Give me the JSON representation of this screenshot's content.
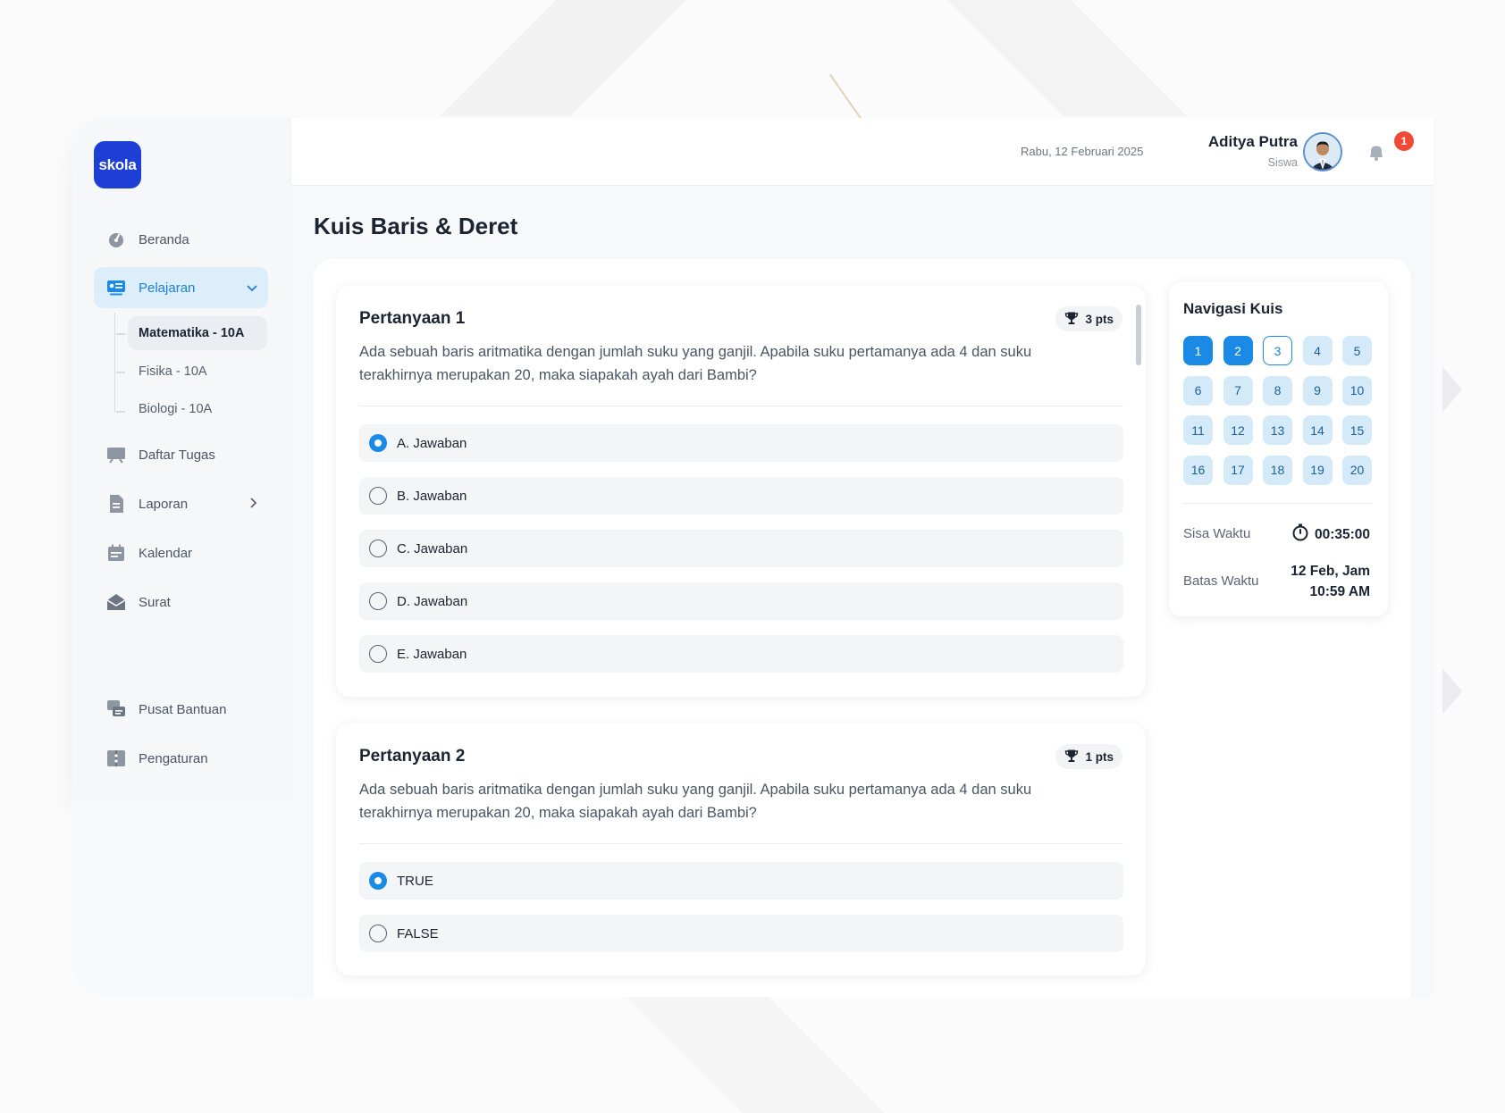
{
  "app": {
    "logo_text": "skola"
  },
  "sidebar": {
    "items": [
      {
        "label": "Beranda",
        "icon": "dashboard-icon"
      },
      {
        "label": "Pelajaran",
        "icon": "lesson-icon"
      },
      {
        "label": "Daftar Tugas",
        "icon": "task-icon"
      },
      {
        "label": "Laporan",
        "icon": "report-icon"
      },
      {
        "label": "Kalendar",
        "icon": "calendar-icon"
      },
      {
        "label": "Surat",
        "icon": "mail-icon"
      },
      {
        "label": "Pusat Bantuan",
        "icon": "help-icon"
      },
      {
        "label": "Pengaturan",
        "icon": "settings-icon"
      }
    ],
    "sub_items": [
      {
        "label": "Matematika - 10A"
      },
      {
        "label": "Fisika - 10A"
      },
      {
        "label": "Biologi - 10A"
      }
    ]
  },
  "header": {
    "date": "Rabu, 12 Februari 2025",
    "user_name": "Aditya Putra",
    "user_role": "Siswa",
    "notification_count": "1"
  },
  "page": {
    "title": "Kuis Baris & Deret"
  },
  "questions": [
    {
      "title": "Pertanyaan 1",
      "points": "3 pts",
      "text": "Ada sebuah baris aritmatika dengan jumlah suku yang ganjil. Apabila suku pertamanya ada 4 dan suku terakhirnya merupakan 20, maka siapakah ayah dari Bambi?",
      "options": [
        "A. Jawaban",
        "B. Jawaban",
        "C. Jawaban",
        "D. Jawaban",
        "E. Jawaban"
      ],
      "selected": 0
    },
    {
      "title": "Pertanyaan 2",
      "points": "1 pts",
      "text": "Ada sebuah baris aritmatika dengan jumlah suku yang ganjil. Apabila suku pertamanya ada 4 dan suku terakhirnya merupakan 20, maka siapakah ayah dari Bambi?",
      "options": [
        "TRUE",
        "FALSE"
      ],
      "selected": 0
    }
  ],
  "quiz_nav": {
    "title": "Navigasi Kuis",
    "numbers": [
      "1",
      "2",
      "3",
      "4",
      "5",
      "6",
      "7",
      "8",
      "9",
      "10",
      "11",
      "12",
      "13",
      "14",
      "15",
      "16",
      "17",
      "18",
      "19",
      "20"
    ],
    "answered": [
      "1",
      "2"
    ],
    "current": "3",
    "remaining_label": "Sisa Waktu",
    "remaining_value": "00:35:00",
    "deadline_label": "Batas Waktu",
    "deadline_line1": "12 Feb, Jam",
    "deadline_line2": "10:59 AM"
  },
  "colors": {
    "primary": "#1a8ae6",
    "brand": "#1e3fd6",
    "badge": "#f04a36"
  }
}
